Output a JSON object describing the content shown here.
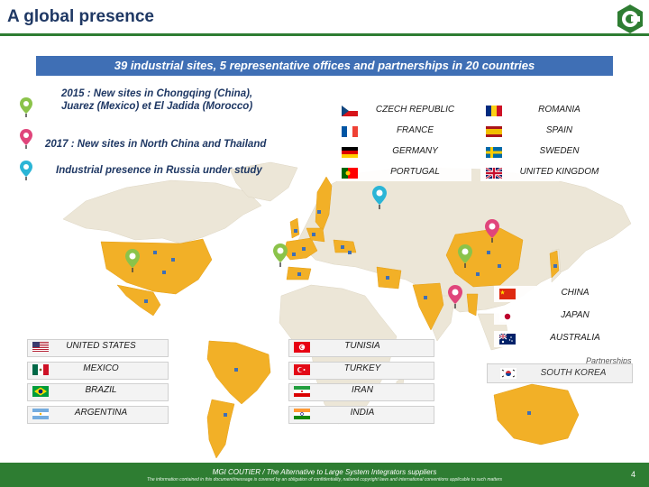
{
  "title": "A global presence",
  "banner": "39 industrial sites, 5 representative offices and partnerships in 20 countries",
  "notes": [
    {
      "text": "2015 : New sites in Chongqing (China),\nJuarez (Mexico) et El Jadida (Morocco)",
      "pin_color": "#8bc34a"
    },
    {
      "text": "2017 : New sites in North China and Thailand",
      "pin_color": "#e0457b"
    },
    {
      "text": "Industrial presence in Russia under study",
      "pin_color": "#2bb5d6"
    }
  ],
  "countries_europe": [
    {
      "name": "CZECH REPUBLIC",
      "flag": "cz"
    },
    {
      "name": "ROMANIA",
      "flag": "ro"
    },
    {
      "name": "FRANCE",
      "flag": "fr"
    },
    {
      "name": "SPAIN",
      "flag": "es"
    },
    {
      "name": "GERMANY",
      "flag": "de"
    },
    {
      "name": "SWEDEN",
      "flag": "se"
    },
    {
      "name": "PORTUGAL",
      "flag": "pt"
    },
    {
      "name": "UNITED KINGDOM",
      "flag": "gb"
    }
  ],
  "countries_asia": [
    {
      "name": "CHINA",
      "flag": "cn"
    },
    {
      "name": "JAPAN",
      "flag": "jp"
    },
    {
      "name": "AUSTRALIA",
      "flag": "au"
    }
  ],
  "countries_americas": [
    {
      "name": "UNITED STATES",
      "flag": "us"
    },
    {
      "name": "MEXICO",
      "flag": "mx"
    },
    {
      "name": "BRAZIL",
      "flag": "br"
    },
    {
      "name": "ARGENTINA",
      "flag": "ar"
    }
  ],
  "countries_other": [
    {
      "name": "TUNISIA",
      "flag": "tn"
    },
    {
      "name": "TURKEY",
      "flag": "tr"
    },
    {
      "name": "IRAN",
      "flag": "ir"
    },
    {
      "name": "INDIA",
      "flag": "in"
    }
  ],
  "partnerships": {
    "label": "Partnerships",
    "country": "SOUTH KOREA",
    "flag": "kr"
  },
  "footer": {
    "line1": "MGI COUTIER / The Alternative to Large System Integrators suppliers",
    "line2": "The information contained in this document/message is covered by an obligation of confidentiality, national copyright laws and international conventions applicable to such matters",
    "page": "4"
  },
  "colors": {
    "title": "#1f3864",
    "banner": "#3f6fb5",
    "footer": "#2e7d32",
    "map_land": "#ece6d7",
    "map_presence": "#f2b027",
    "pin_2015": "#8bc34a",
    "pin_2017": "#e0457b",
    "pin_russia": "#2bb5d6"
  }
}
